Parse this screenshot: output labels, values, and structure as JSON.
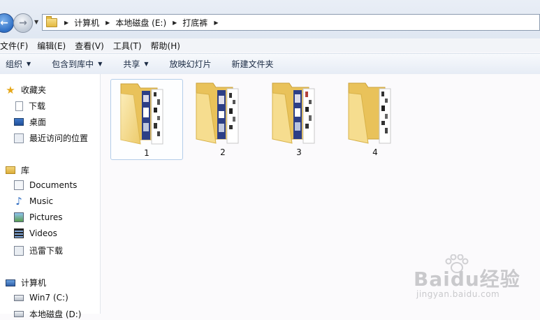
{
  "address_bar": {
    "breadcrumbs": [
      "计算机",
      "本地磁盘 (E:)",
      "打底裤"
    ]
  },
  "menu": [
    "文件(F)",
    "编辑(E)",
    "查看(V)",
    "工具(T)",
    "帮助(H)"
  ],
  "toolbar": {
    "organize": "组织",
    "include_in_library": "包含到库中",
    "share": "共享",
    "slideshow": "放映幻灯片",
    "new_folder": "新建文件夹"
  },
  "sidebar": {
    "favorites": {
      "label": "收藏夹",
      "items": [
        "下载",
        "桌面",
        "最近访问的位置"
      ]
    },
    "libraries": {
      "label": "库",
      "items": [
        "Documents",
        "Music",
        "Pictures",
        "Videos",
        "迅雷下载"
      ]
    },
    "computer": {
      "label": "计算机",
      "items": [
        "Win7 (C:)",
        "本地磁盘 (D:)"
      ]
    }
  },
  "folders": [
    {
      "name": "1",
      "selected": true
    },
    {
      "name": "2",
      "selected": false
    },
    {
      "name": "3",
      "selected": false
    },
    {
      "name": "4",
      "selected": false
    }
  ],
  "watermark": {
    "logo": "Baidu经验",
    "url": "jingyan.baidu.com"
  },
  "colors": {
    "folder_yellow": "#f3d36f",
    "selection_border": "#b3cde9",
    "toolbar_text": "#1b2b44"
  }
}
